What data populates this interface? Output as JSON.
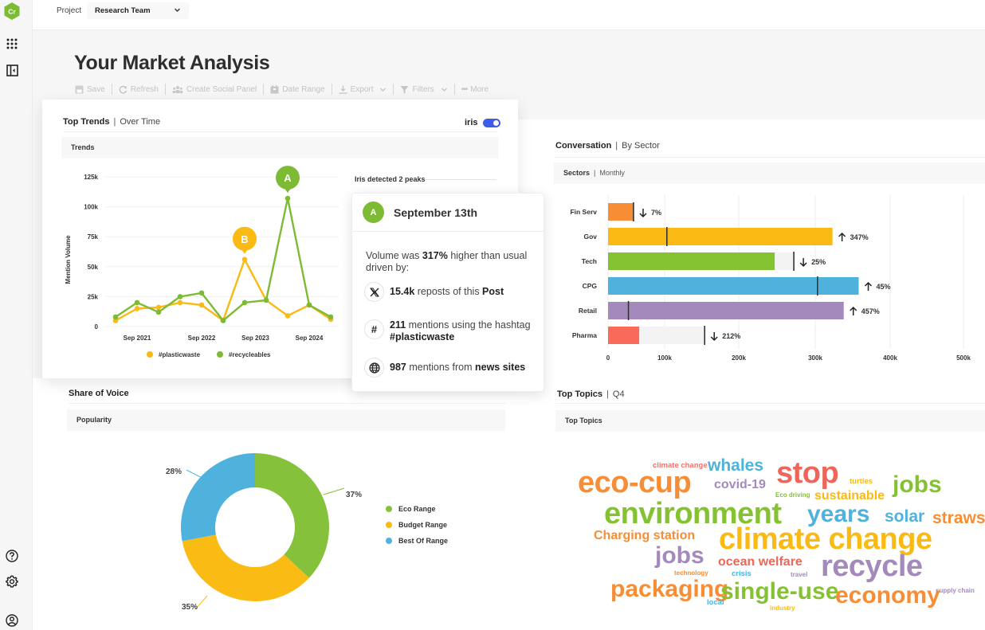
{
  "app": {
    "logo_text": "Cr",
    "brand_color": "#7dbb34"
  },
  "topbar": {
    "project_label": "Project",
    "project_value": "Research Team"
  },
  "sidebar": {
    "top_icons": [
      "apps-grid-icon",
      "collapse-panel-icon"
    ],
    "bottom_icons": [
      "help-icon",
      "settings-icon",
      "account-icon"
    ]
  },
  "page": {
    "title": "Your Market Analysis"
  },
  "toolbar": {
    "save": "Save",
    "refresh": "Refresh",
    "create_social_panel": "Create Social Panel",
    "date_range": "Date Range",
    "export": "Export",
    "filters": "Filters",
    "more": "More"
  },
  "top_trends": {
    "title": "Top Trends",
    "subtitle": "Over Time",
    "iris_label": "iris",
    "iris_enabled": true,
    "subbar": "Trends",
    "peaks_label": "Iris detected 2 peaks"
  },
  "popup": {
    "badge": "A",
    "date": "September 13th",
    "intro_pre": "Volume was ",
    "intro_pct": "317%",
    "intro_post": " higher than usual driven by:",
    "drivers": [
      {
        "icon": "x-logo-icon",
        "glyph": "𝕏",
        "bold": "15.4k",
        "text": " reposts of this ",
        "bold2": "Post"
      },
      {
        "icon": "hashtag-icon",
        "glyph": "#",
        "bold": "211",
        "text": " mentions using the hashtag ",
        "bold2": "#plasticwaste"
      },
      {
        "icon": "globe-icon",
        "glyph": "",
        "bold": "987",
        "text": " mentions from ",
        "bold2": "news sites"
      }
    ]
  },
  "conversation": {
    "title": "Conversation",
    "subtitle": "By Sector",
    "subbar_bold": "Sectors",
    "subbar_sub": "Monthly"
  },
  "share_of_voice": {
    "title": "Share of Voice",
    "subbar": "Popularity"
  },
  "top_topics": {
    "title": "Top Topics",
    "subtitle": "Q4",
    "subbar": "Top Topics"
  },
  "chart_data": [
    {
      "type": "line",
      "title": "Trends",
      "ylabel": "Mention Volume",
      "xlabel": "",
      "ylim": [
        0,
        125000
      ],
      "yticks": [
        0,
        25000,
        50000,
        75000,
        100000,
        125000
      ],
      "ytick_labels": [
        "0",
        "25k",
        "50k",
        "75k",
        "100k",
        "125k"
      ],
      "xtick_labels": [
        {
          "label": "Sep 2021",
          "index": 1
        },
        {
          "label": "Sep 2022",
          "index": 4
        },
        {
          "label": "Sep 2023",
          "index": 6.5
        },
        {
          "label": "Sep 2024",
          "index": 9
        }
      ],
      "grid": true,
      "legend": "bottom",
      "series": [
        {
          "name": "#plasticwaste",
          "color": "#fbb914",
          "values": [
            5000,
            15000,
            16000,
            20000,
            18000,
            5000,
            56000,
            22000,
            9000,
            18000,
            6000
          ]
        },
        {
          "name": "#recycleables",
          "color": "#7dbb34",
          "values": [
            8000,
            20000,
            12000,
            25000,
            28000,
            5000,
            20000,
            22000,
            107000,
            18000,
            8000
          ]
        }
      ],
      "annotations": [
        {
          "label": "A",
          "series": "#recycleables",
          "index": 8,
          "color": "#7dbb34"
        },
        {
          "label": "B",
          "series": "#plasticwaste",
          "index": 6,
          "color": "#fbb914"
        }
      ]
    },
    {
      "type": "bar",
      "orientation": "horizontal",
      "title": "Sectors | Monthly",
      "categories": [
        "Fin Serv",
        "Gov",
        "Tech",
        "CPG",
        "Retail",
        "Pharma"
      ],
      "values": [
        45000,
        323000,
        247000,
        358000,
        338000,
        55000
      ],
      "previous": [
        45000,
        103000,
        272000,
        303000,
        36000,
        154000
      ],
      "change_labels": [
        "7%",
        "347%",
        "25%",
        "45%",
        "457%",
        "212%"
      ],
      "change_direction": [
        "down",
        "up",
        "down",
        "up",
        "up",
        "down"
      ],
      "colors": [
        "#f78d34",
        "#fbb914",
        "#84c232",
        "#4fb2dc",
        "#a48abc",
        "#fa6a58"
      ],
      "xticks": [
        0,
        100000,
        200000,
        300000,
        400000,
        500000
      ],
      "xtick_labels": [
        "0",
        "100k",
        "200k",
        "300k",
        "400k",
        "500k"
      ],
      "xlim": [
        0,
        500000
      ],
      "grid": true
    },
    {
      "type": "pie",
      "donut": true,
      "title": "Popularity",
      "categories": [
        "Eco Range",
        "Budget Range",
        "Best Of Range"
      ],
      "values": [
        37,
        35,
        28
      ],
      "labels": [
        "37%",
        "35%",
        "28%"
      ],
      "colors": [
        "#85c13a",
        "#fbbb15",
        "#4fb2dc"
      ],
      "legend": "right"
    }
  ],
  "word_cloud": [
    {
      "text": "climate change",
      "color": "#f0726a",
      "size": "xs"
    },
    {
      "text": "whales",
      "color": "#4fb2dc",
      "size": "m"
    },
    {
      "text": "stop",
      "color": "#f0655a",
      "size": "xl"
    },
    {
      "text": "eco-cup",
      "color": "#f78d34",
      "size": "xl"
    },
    {
      "text": "covid-19",
      "color": "#a48abc",
      "size": "s"
    },
    {
      "text": "turtles",
      "color": "#fbb914",
      "size": "xs"
    },
    {
      "text": "jobs",
      "color": "#84c232",
      "size": "l"
    },
    {
      "text": "Eco driving",
      "color": "#84c232",
      "size": "xxs"
    },
    {
      "text": "sustainable",
      "color": "#fbb914",
      "size": "s"
    },
    {
      "text": "environment",
      "color": "#84c232",
      "size": "xl"
    },
    {
      "text": "years",
      "color": "#4fb2dc",
      "size": "l"
    },
    {
      "text": "solar",
      "color": "#4fb2dc",
      "size": "m"
    },
    {
      "text": "straws",
      "color": "#f78d34",
      "size": "m"
    },
    {
      "text": "Charging station",
      "color": "#f78d34",
      "size": "s"
    },
    {
      "text": "climate change",
      "color": "#fbb914",
      "size": "xl"
    },
    {
      "text": "jobs",
      "color": "#a48abc",
      "size": "l"
    },
    {
      "text": "ocean welfare",
      "color": "#f0655a",
      "size": "s"
    },
    {
      "text": "technology",
      "color": "#f78d34",
      "size": "xxs"
    },
    {
      "text": "crisis",
      "color": "#4fb2dc",
      "size": "xs"
    },
    {
      "text": "travel",
      "color": "#a48abc",
      "size": "xxs"
    },
    {
      "text": "recycle",
      "color": "#a48abc",
      "size": "xl"
    },
    {
      "text": "packaging",
      "color": "#f78d34",
      "size": "l"
    },
    {
      "text": "single-use",
      "color": "#84c232",
      "size": "l"
    },
    {
      "text": "economy",
      "color": "#f78d34",
      "size": "l"
    },
    {
      "text": "supply chain",
      "color": "#a48abc",
      "size": "xxs"
    },
    {
      "text": "local",
      "color": "#4fb2dc",
      "size": "xs"
    },
    {
      "text": "industry",
      "color": "#fbb914",
      "size": "xxs"
    }
  ]
}
